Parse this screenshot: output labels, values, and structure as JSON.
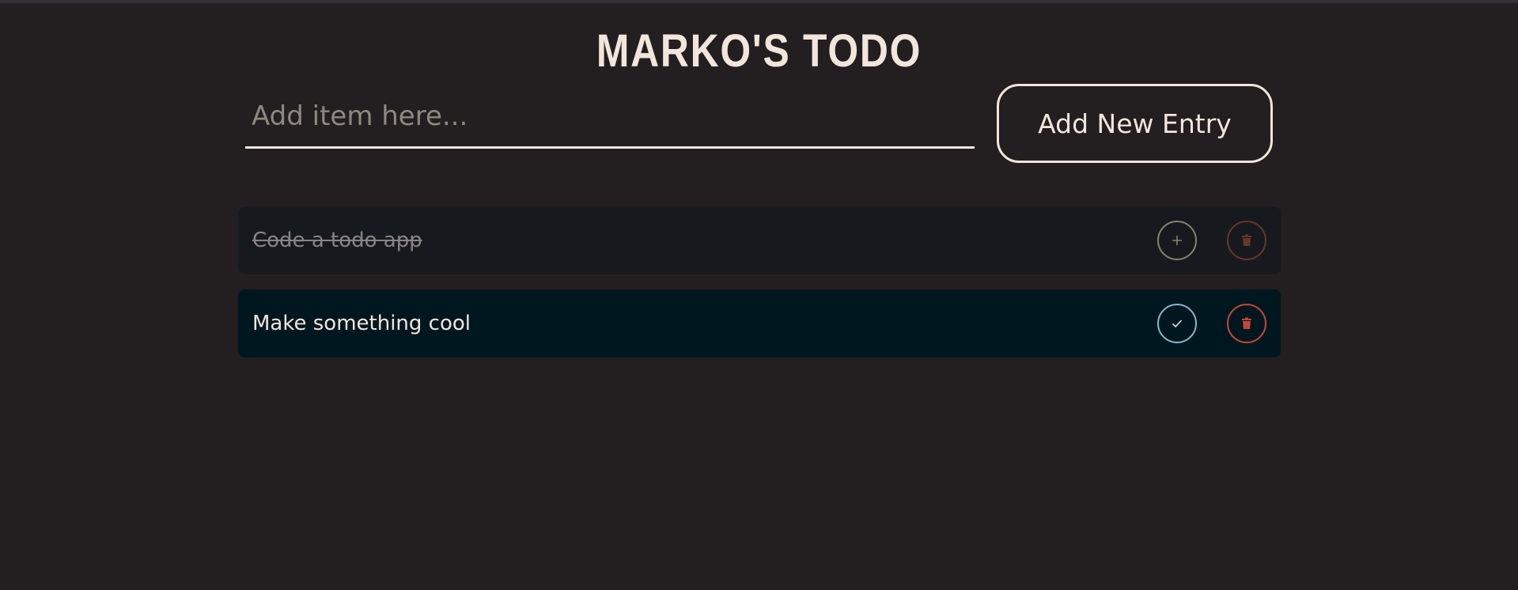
{
  "app": {
    "title": "MARKO'S TODO"
  },
  "entry": {
    "placeholder": "Add item here...",
    "value": "",
    "add_label": "Add New Entry"
  },
  "todos": [
    {
      "text": "Code a todo app",
      "completed": true,
      "toggle_icon": "plus-icon",
      "delete_icon": "trash-icon"
    },
    {
      "text": "Make something cool",
      "completed": false,
      "toggle_icon": "check-icon",
      "delete_icon": "trash-icon"
    }
  ],
  "colors": {
    "background": "#231f20",
    "text": "#f2e6dc",
    "completed_item_bg": "#161a1f",
    "active_item_bg": "#00171f",
    "check_accent": "#86b8c8",
    "delete_accent": "#c5473a"
  }
}
